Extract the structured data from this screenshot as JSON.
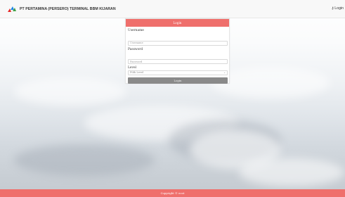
{
  "header": {
    "brand_text": "PT PERTAMINA (PERSERO) TERMINAL BBM KIJARAN",
    "login_link": "Login"
  },
  "login_panel": {
    "title": "Login",
    "username_label": "Username",
    "username_placeholder": "Username",
    "password_label": "Password",
    "password_placeholder": "Password",
    "level_label": "Level",
    "level_selected": "Pilih Level",
    "submit_label": "Login"
  },
  "footer": {
    "text": "Copyright © ecnt"
  },
  "colors": {
    "accent": "#ef6f6c",
    "button": "#8a8a8a"
  },
  "icons": {
    "brand": "pertamina-logo",
    "login": "key-icon",
    "select": "chevron-down-icon"
  }
}
